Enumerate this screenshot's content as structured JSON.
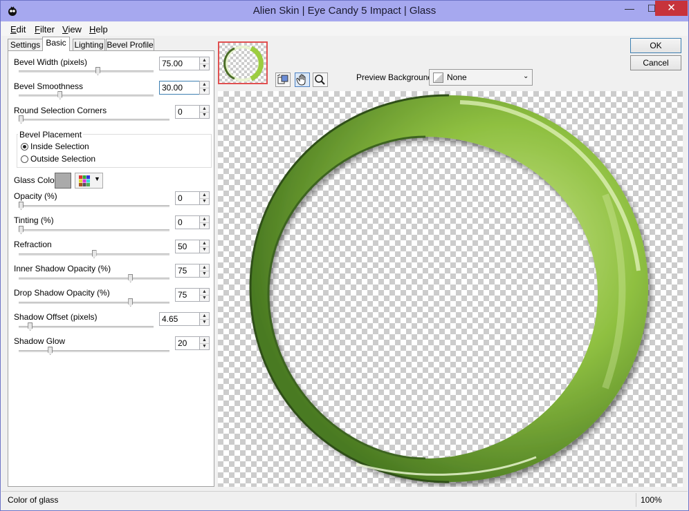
{
  "window": {
    "title": "Alien Skin | Eye Candy 5 Impact | Glass",
    "minimize": "—",
    "maximize": "☐",
    "close": "✕"
  },
  "menu": [
    {
      "label": "Edit",
      "key": "E",
      "rest": "dit"
    },
    {
      "label": "Filter",
      "key": "F",
      "rest": "ilter"
    },
    {
      "label": "View",
      "key": "V",
      "rest": "iew"
    },
    {
      "label": "Help",
      "key": "H",
      "rest": "elp"
    }
  ],
  "tabs": [
    "Settings",
    "Basic",
    "Lighting",
    "Bevel Profile"
  ],
  "active_tab": "Basic",
  "controls": {
    "bevel_width": {
      "label": "Bevel Width (pixels)",
      "value": "75.00",
      "slider": 0.59
    },
    "bevel_smoothness": {
      "label": "Bevel Smoothness",
      "value": "30.00",
      "slider": 0.3
    },
    "round_corners": {
      "label": "Round Selection Corners",
      "value": "0",
      "slider": 0.0
    },
    "bevel_placement": {
      "title": "Bevel Placement",
      "inside": "Inside Selection",
      "outside": "Outside Selection",
      "selected": "inside"
    },
    "glass_color": {
      "label": "Glass Color",
      "swatch": "#aaaaaa"
    },
    "opacity": {
      "label": "Opacity (%)",
      "value": "0",
      "slider": 0.0
    },
    "tinting": {
      "label": "Tinting (%)",
      "value": "0",
      "slider": 0.0
    },
    "refraction": {
      "label": "Refraction",
      "value": "50",
      "slider": 0.5
    },
    "inner_shadow": {
      "label": "Inner Shadow Opacity (%)",
      "value": "75",
      "slider": 0.75
    },
    "drop_shadow": {
      "label": "Drop Shadow Opacity (%)",
      "value": "75",
      "slider": 0.75
    },
    "shadow_offset": {
      "label": "Shadow Offset (pixels)",
      "value": "4.65",
      "slider": 0.07
    },
    "shadow_glow": {
      "label": "Shadow Glow",
      "value": "20",
      "slider": 0.2
    }
  },
  "preview": {
    "background_label": "Preview Background:",
    "background_value": "None",
    "tools": [
      "preview-toggle-icon",
      "hand-icon",
      "zoom-icon"
    ]
  },
  "buttons": {
    "ok": "OK",
    "cancel": "Cancel"
  },
  "status": {
    "text": "Color of glass",
    "zoom": "100%"
  },
  "colors": {
    "glass_green": "#86b83a",
    "glass_dark": "#3f6b1f",
    "accent_blue": "#3c7fb1"
  }
}
